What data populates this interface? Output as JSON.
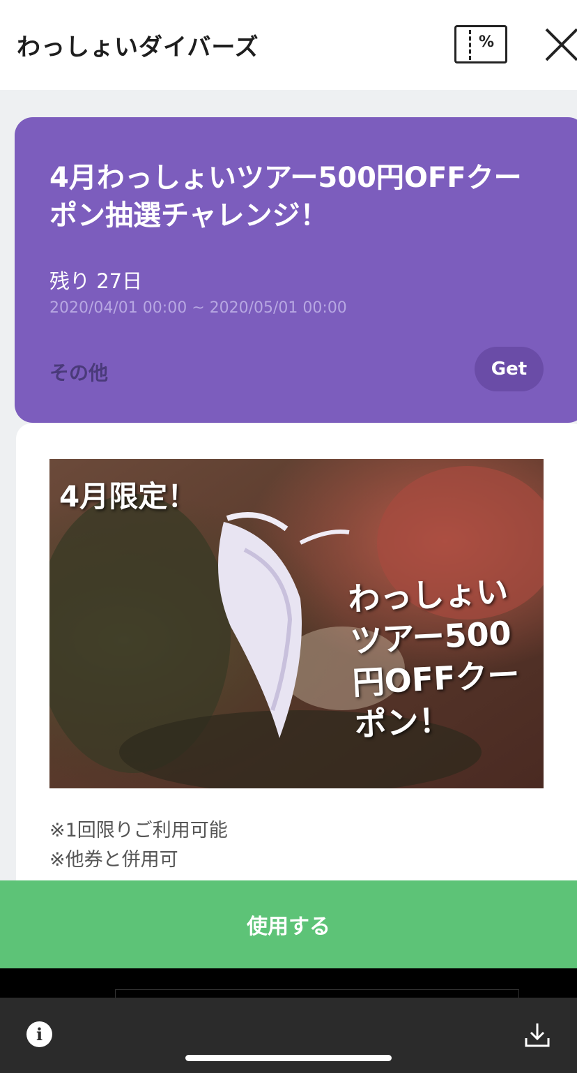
{
  "header": {
    "title": "わっしょいダイバーズ",
    "coupon_icon_symbol": "%"
  },
  "card": {
    "title": "4月わっしょいツアー500円OFFクーポン抽選チャレンジ！",
    "remaining": "残り 27日",
    "period": "2020/04/01 00:00 ~ 2020/05/01 00:00",
    "category": "その他",
    "get_label": "Get",
    "background_color": "#7c5dbd"
  },
  "detail": {
    "photo_text_limited": "4月限定！",
    "photo_text_main": "わっしょいツアー500円OFFクーポン！",
    "notes": [
      "※1回限りご利用可能",
      "※他券と併用可"
    ]
  },
  "footer": {
    "use_label": "使用する",
    "use_color": "#5dc377"
  },
  "system_bar": {
    "info_symbol": "i"
  }
}
